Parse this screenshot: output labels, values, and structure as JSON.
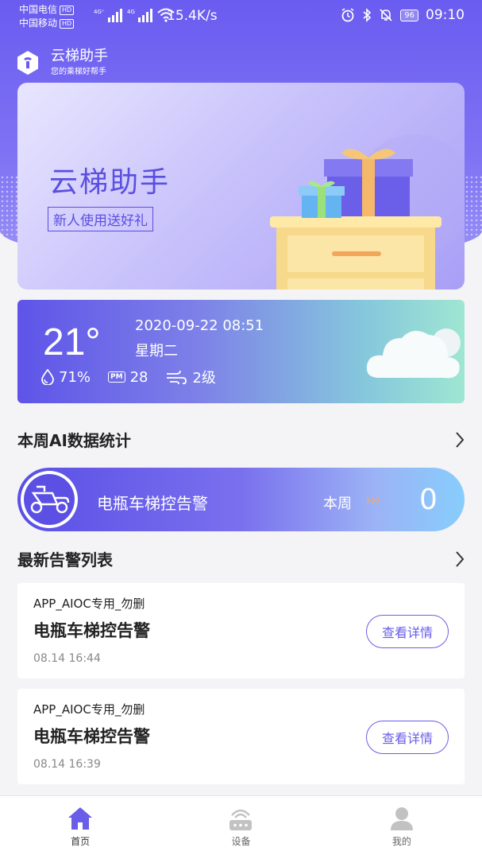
{
  "status_bar": {
    "carrier1": "中国电信",
    "carrier2": "中国移动",
    "hd": "HD",
    "net_speed": "15.4K/s",
    "battery": "96",
    "time": "09:10"
  },
  "app": {
    "title": "云梯助手",
    "subtitle": "您的乘梯好帮手"
  },
  "banner": {
    "title": "云梯助手",
    "button": "新人使用送好礼"
  },
  "weather": {
    "temperature": "21°",
    "datetime": "2020-09-22 08:51",
    "weekday": "星期二",
    "humidity": "71%",
    "pm_badge": "PM",
    "pm_value": "28",
    "wind": "2级"
  },
  "weekly_stats": {
    "title": "本周AI数据统计",
    "label": "电瓶车梯控告警",
    "period": "本周",
    "arrows": "›››",
    "value": "0"
  },
  "alerts": {
    "title": "最新告警列表",
    "items": [
      {
        "source": "APP_AIOC专用_勿删",
        "title": "电瓶车梯控告警",
        "time": "08.14 16:44",
        "button": "查看详情"
      },
      {
        "source": "APP_AIOC专用_勿删",
        "title": "电瓶车梯控告警",
        "time": "08.14 16:39",
        "button": "查看详情"
      }
    ]
  },
  "tabbar": {
    "items": [
      {
        "label": "首页",
        "icon": "home-icon",
        "color": "#6a5de8"
      },
      {
        "label": "设备",
        "icon": "router-icon",
        "color": "#b8b8b8"
      },
      {
        "label": "我的",
        "icon": "user-icon",
        "color": "#b8b8b8"
      }
    ]
  },
  "colors": {
    "primary": "#6a5de8",
    "accent_arrows": "#f6a96a"
  }
}
